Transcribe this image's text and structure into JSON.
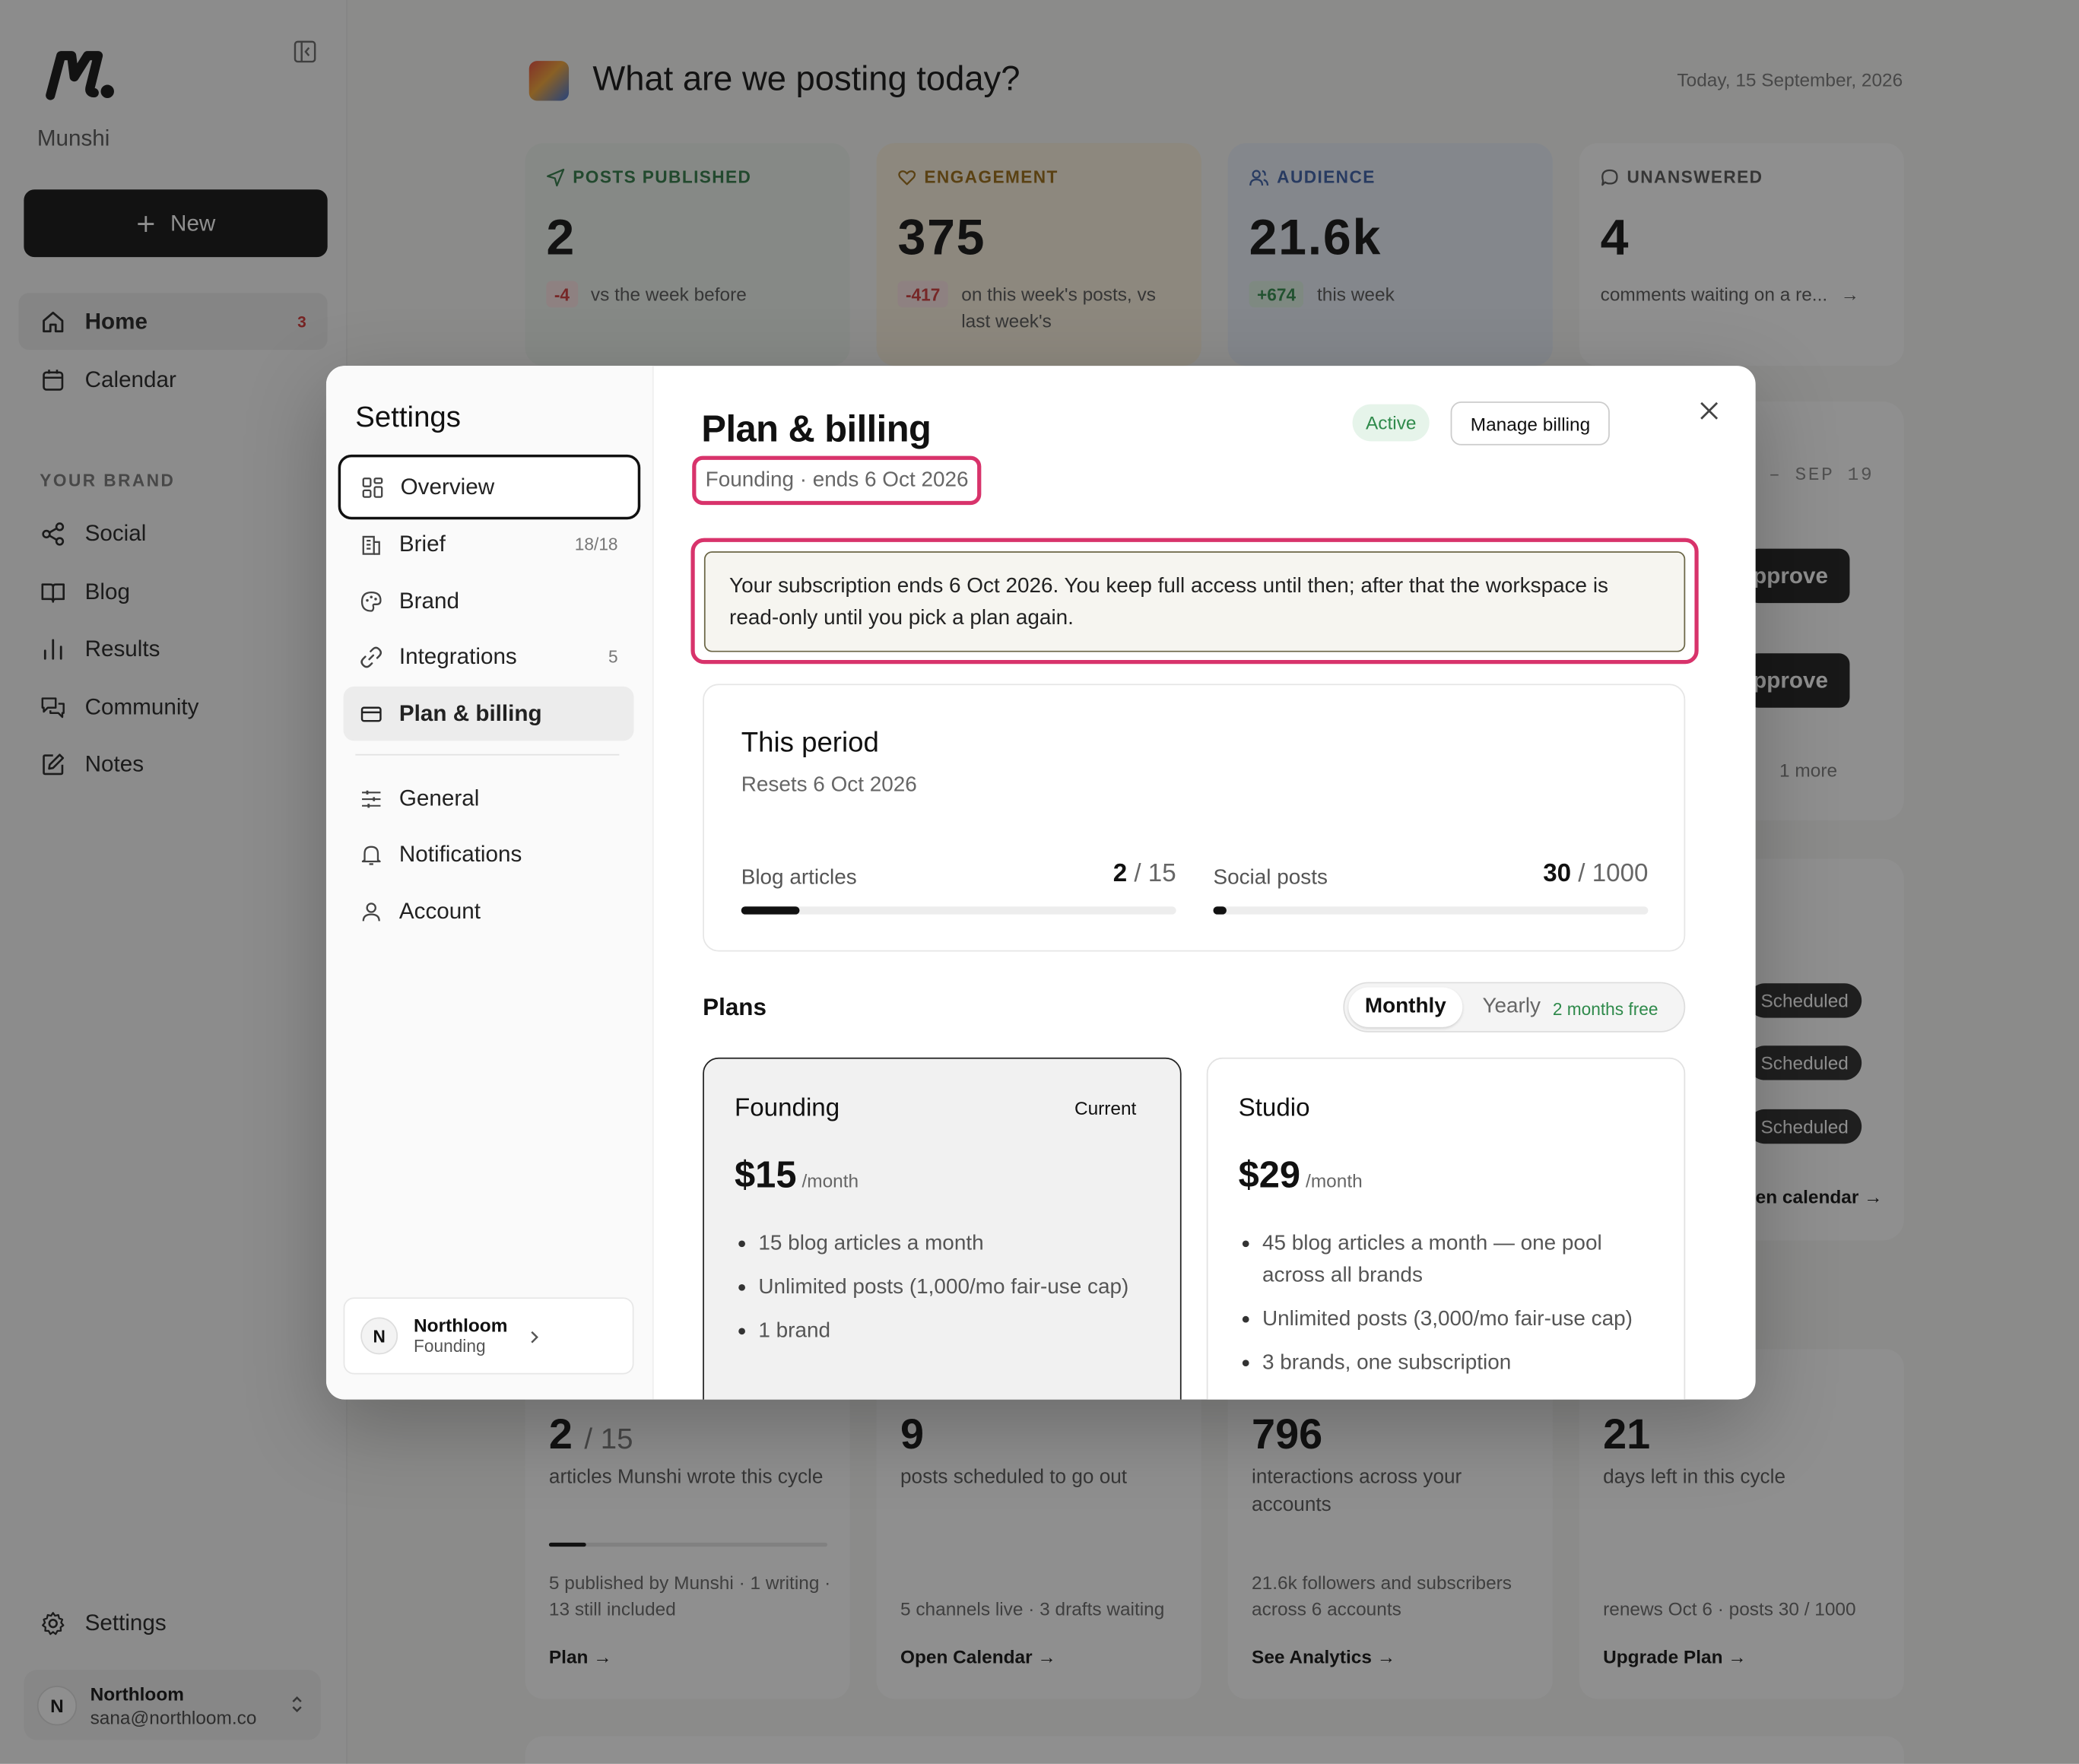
{
  "app": {
    "name": "Munshi",
    "new_label": "New"
  },
  "sidebar": {
    "items": [
      {
        "label": "Home",
        "badge": "3"
      },
      {
        "label": "Calendar"
      }
    ],
    "section_label": "YOUR BRAND",
    "brand_items": [
      {
        "label": "Social"
      },
      {
        "label": "Blog"
      },
      {
        "label": "Results"
      },
      {
        "label": "Community"
      },
      {
        "label": "Notes"
      }
    ],
    "settings_label": "Settings",
    "user": {
      "initial": "N",
      "name": "Northloom",
      "email": "sana@northloom.co"
    }
  },
  "header": {
    "greeting": "What are we posting today?",
    "date": "Today, 15 September, 2026"
  },
  "stats": [
    {
      "label": "POSTS PUBLISHED",
      "value": "2",
      "chip": "-4",
      "text": "vs the week before",
      "color": "#2e7a45"
    },
    {
      "label": "ENGAGEMENT",
      "value": "375",
      "chip": "-417",
      "text": "on this week's posts, vs last week's",
      "color": "#9a6a12"
    },
    {
      "label": "AUDIENCE",
      "value": "21.6k",
      "chip": "+674",
      "text": "this week",
      "color": "#3b5ea8"
    },
    {
      "label": "UNANSWERED",
      "value": "4",
      "text": "comments waiting on a re...",
      "arrow": "→",
      "color": "#555555"
    }
  ],
  "background_right": {
    "date_range": "– SEP 19",
    "approve_label": "pprove",
    "more_label": "1 more",
    "scheduled_label": "Scheduled",
    "calendar_link": "en calendar →"
  },
  "bottom_cards": [
    {
      "big": "2",
      "big_small": "/ 15",
      "desc": "articles Munshi wrote this cycle",
      "foot": "5 published by Munshi · 1 writing · 13 still included",
      "link": "Plan →"
    },
    {
      "big": "9",
      "desc": "posts scheduled to go out",
      "foot": "5 channels live · 3 drafts waiting",
      "link": "Open Calendar →"
    },
    {
      "big": "796",
      "desc": "interactions across your accounts",
      "foot": "21.6k followers and subscribers across 6 accounts",
      "link": "See Analytics →"
    },
    {
      "big": "21",
      "desc": "days left in this cycle",
      "foot": "renews Oct 6 · posts 30 / 1000",
      "link": "Upgrade Plan →"
    }
  ],
  "settings": {
    "title": "Settings",
    "nav": [
      {
        "label": "Overview"
      },
      {
        "label": "Brief",
        "count": "18/18"
      },
      {
        "label": "Brand"
      },
      {
        "label": "Integrations",
        "count": "5"
      },
      {
        "label": "Plan & billing"
      },
      {
        "label": "General"
      },
      {
        "label": "Notifications"
      },
      {
        "label": "Account"
      }
    ],
    "workspace": {
      "initial": "N",
      "name": "Northloom",
      "plan": "Founding"
    }
  },
  "billing": {
    "title": "Plan & billing",
    "subtitle": "Founding · ends 6 Oct 2026",
    "status": "Active",
    "manage_label": "Manage billing",
    "notice": "Your subscription ends 6 Oct 2026. You keep full access until then; after that the workspace is read-only until you pick a plan again.",
    "period": {
      "title": "This period",
      "resets": "Resets 6 Oct 2026",
      "meters": [
        {
          "label": "Blog articles",
          "used": "2",
          "limit": "/ 15",
          "fraction": 0.133
        },
        {
          "label": "Social posts",
          "used": "30",
          "limit": "/ 1000",
          "fraction": 0.03
        }
      ]
    },
    "plans_heading": "Plans",
    "toggle": {
      "monthly": "Monthly",
      "yearly": "Yearly",
      "yearly_note": "2 months free"
    },
    "plans": [
      {
        "name": "Founding",
        "tag": "Current",
        "price": "$15",
        "period": "/month",
        "features": [
          "15 blog articles a month",
          "Unlimited posts (1,000/mo fair-use cap)",
          "1 brand"
        ]
      },
      {
        "name": "Studio",
        "price": "$29",
        "period": "/month",
        "features": [
          "45 blog articles a month — one pool across all brands",
          "Unlimited posts (3,000/mo fair-use cap)",
          "3 brands, one subscription"
        ]
      }
    ]
  }
}
